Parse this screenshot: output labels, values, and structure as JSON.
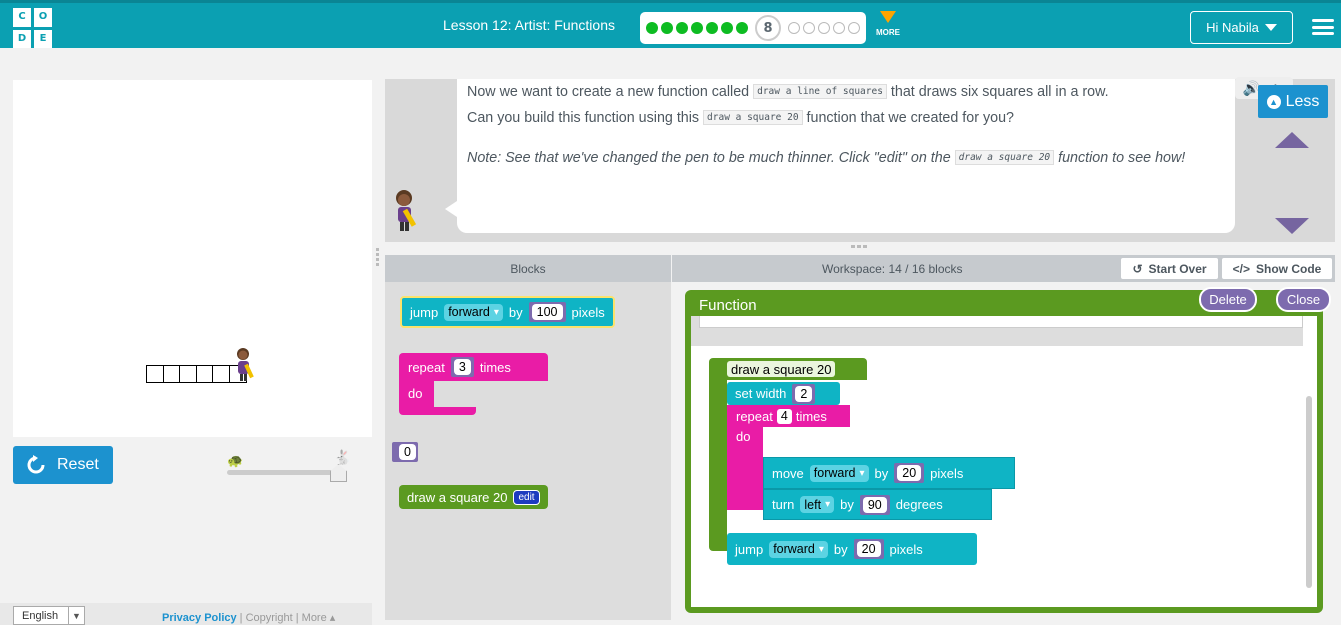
{
  "header": {
    "logo_letters": [
      "C",
      "O",
      "D",
      "E"
    ],
    "lesson_title": "Lesson 12: Artist: Functions",
    "progress": {
      "completed": 7,
      "current_level": "8",
      "remaining": 5
    },
    "more_label": "MORE",
    "user_greeting": "Hi Nabila",
    "accent_color": "#0ba0b2",
    "more_color": "#ffa400"
  },
  "visualization": {
    "squares_drawn": 6,
    "reset_label": "Reset",
    "speed_slider": {
      "min_icon": "turtle-icon",
      "max_icon": "rabbit-icon",
      "level": 1.0
    }
  },
  "footer": {
    "language": "English",
    "privacy": "Privacy Policy",
    "sep1": "|",
    "copyright": "Copyright",
    "sep2": "|",
    "more": "More ▴"
  },
  "instructions": {
    "line1_pre": "Now we want to create a new function called ",
    "line1_code": "draw a line of squares",
    "line1_post": " that draws six squares all in a row.",
    "line2_pre": "Can you build this function using this ",
    "line2_code": "draw a square 20",
    "line2_post": " function that we created for you?",
    "note_pre": "Note: See that we've changed the pen to be much thinner. Click \"edit\" on the ",
    "note_code": "draw a square 20",
    "note_post": " function to see how!",
    "less_label": "Less",
    "speaker_icon": "🔊",
    "play_icon": "▶"
  },
  "workspace": {
    "blocks_header": "Blocks",
    "count_label": "Workspace: 14 / 16 blocks",
    "start_over_label": "Start Over",
    "show_code_label": "Show Code"
  },
  "toolbox": {
    "jump": {
      "label": "jump",
      "direction": "forward",
      "by": "by",
      "value": "100",
      "unit": "pixels"
    },
    "repeat": {
      "label": "repeat",
      "value": "3",
      "times": "times",
      "do": "do"
    },
    "number": {
      "value": "0"
    },
    "function_call": {
      "label": "draw a square 20",
      "edit": "edit"
    }
  },
  "function_editor": {
    "title": "Function",
    "delete_label": "Delete",
    "close_label": "Close",
    "definition_name": "draw a square 20",
    "set_width": {
      "label": "set width",
      "value": "2"
    },
    "repeat": {
      "label": "repeat",
      "value": "4",
      "times": "times",
      "do": "do"
    },
    "move": {
      "label": "move",
      "direction": "forward",
      "by": "by",
      "value": "20",
      "unit": "pixels"
    },
    "turn": {
      "label": "turn",
      "direction": "left",
      "by": "by",
      "value": "90",
      "unit": "degrees"
    },
    "jump": {
      "label": "jump",
      "direction": "forward",
      "by": "by",
      "value": "20",
      "unit": "pixels"
    }
  }
}
